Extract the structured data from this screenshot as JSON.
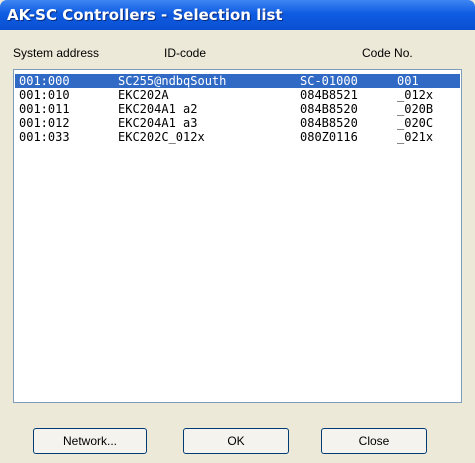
{
  "window": {
    "title": "AK-SC Controllers - Selection list"
  },
  "columns": {
    "system_address": "System address",
    "id_code": "ID-code",
    "code_no": "Code No."
  },
  "rows": [
    {
      "address": "001:000",
      "id": "SC255@ndbqSouth",
      "code": "SC-01000",
      "sub": "001",
      "selected": true
    },
    {
      "address": "001:010",
      "id": "EKC202A",
      "code": "084B8521",
      "sub": "_012x",
      "selected": false
    },
    {
      "address": "001:011",
      "id": "EKC204A1 a2",
      "code": "084B8520",
      "sub": "_020B",
      "selected": false
    },
    {
      "address": "001:012",
      "id": "EKC204A1 a3",
      "code": "084B8520",
      "sub": "_020C",
      "selected": false
    },
    {
      "address": "001:033",
      "id": "EKC202C_012x",
      "code": "080Z0116",
      "sub": "_021x",
      "selected": false
    }
  ],
  "buttons": {
    "network": "Network...",
    "ok": "OK",
    "close": "Close"
  },
  "colors": {
    "title_bar": "#0a4fd2",
    "selection": "#316ac5",
    "face": "#ece9d8"
  }
}
